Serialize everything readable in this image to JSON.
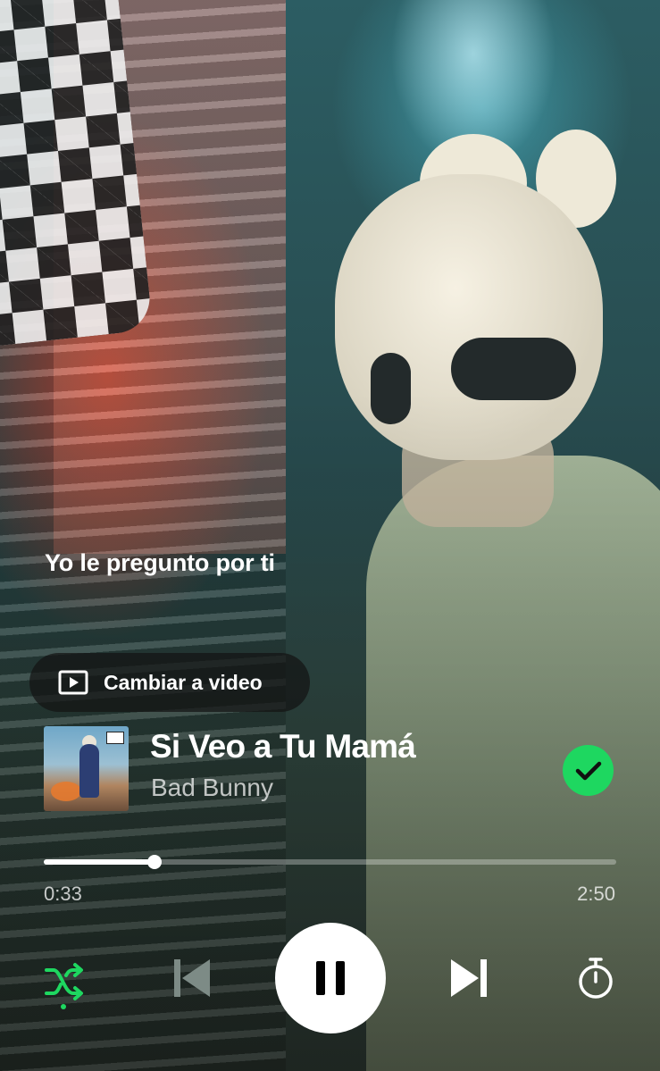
{
  "lyrics": {
    "current_line": "Yo le pregunto por ti"
  },
  "video_toggle": {
    "label": "Cambiar a video",
    "icon": "video-play-icon"
  },
  "track": {
    "title": "Si Veo a Tu Mamá",
    "artist": "Bad Bunny",
    "saved": true,
    "saved_icon": "check-circle-icon"
  },
  "progress": {
    "elapsed": "0:33",
    "duration": "2:50",
    "fraction": 0.194
  },
  "controls": {
    "shuffle": {
      "icon": "shuffle-icon",
      "active": true
    },
    "previous": {
      "icon": "skip-previous-icon",
      "enabled": false
    },
    "play_pause": {
      "icon": "pause-icon",
      "state": "playing"
    },
    "next": {
      "icon": "skip-next-icon",
      "enabled": true
    },
    "sleep_timer": {
      "icon": "timer-icon"
    }
  },
  "colors": {
    "accent": "#1ed760",
    "text": "#ffffff",
    "disabled": "#7d8b86"
  }
}
